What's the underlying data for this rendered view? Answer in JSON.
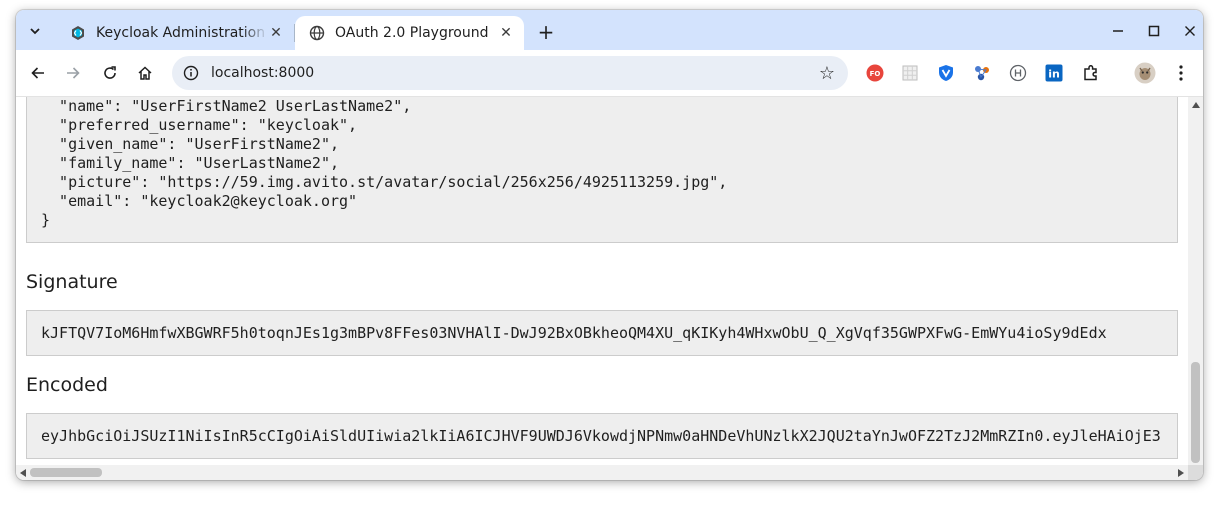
{
  "browser": {
    "tabs": [
      {
        "title": "Keycloak Administration",
        "active": false,
        "favicon": "keycloak-icon"
      },
      {
        "title": "OAuth 2.0 Playground",
        "active": true,
        "favicon": "globe-icon"
      }
    ],
    "url": "localhost:8000",
    "extensions": [
      {
        "name": "fo-extension-icon",
        "label": "FO",
        "color": "#e8453c"
      },
      {
        "name": "grid-extension-icon",
        "color": "#bdbdbd"
      },
      {
        "name": "vpn-shield-extension-icon",
        "color": "#1a73e8"
      },
      {
        "name": "network-extension-icon",
        "color": "#4a7bd0"
      },
      {
        "name": "hierarchy-extension-icon",
        "color": "#5f6368"
      },
      {
        "name": "linkedin-extension-icon",
        "label": "in",
        "color": "#0a66c2"
      },
      {
        "name": "puzzle-extensions-icon",
        "color": "#1f1f1f"
      }
    ]
  },
  "page": {
    "payload_lines": [
      "  \"name\": \"UserFirstName2 UserLastName2\",",
      "  \"preferred_username\": \"keycloak\",",
      "  \"given_name\": \"UserFirstName2\",",
      "  \"family_name\": \"UserLastName2\",",
      "  \"picture\": \"https://59.img.avito.st/avatar/social/256x256/4925113259.jpg\",",
      "  \"email\": \"keycloak2@keycloak.org\"",
      "}"
    ],
    "signature_heading": "Signature",
    "signature_value": "kJFTQV7IoM6HmfwXBGWRF5h0toqnJEs1g3mBPv8FFes03NVHAlI-DwJ92BxOBkheoQM4XU_qKIKyh4WHxwObU_Q_XgVqf35GWPXFwG-EmWYu4ioSy9dEdx",
    "encoded_heading": "Encoded",
    "encoded_value": "eyJhbGciOiJSUzI1NiIsInR5cCIgOiAiSldUIiwia2lkIiA6ICJHVF9UWDJ6VkowdjNPNmw0aHNDeVhUNzlkX2JQU2taYnJwOFZ2TzJ2MmRZIn0.eyJleHAiOjE3"
  }
}
